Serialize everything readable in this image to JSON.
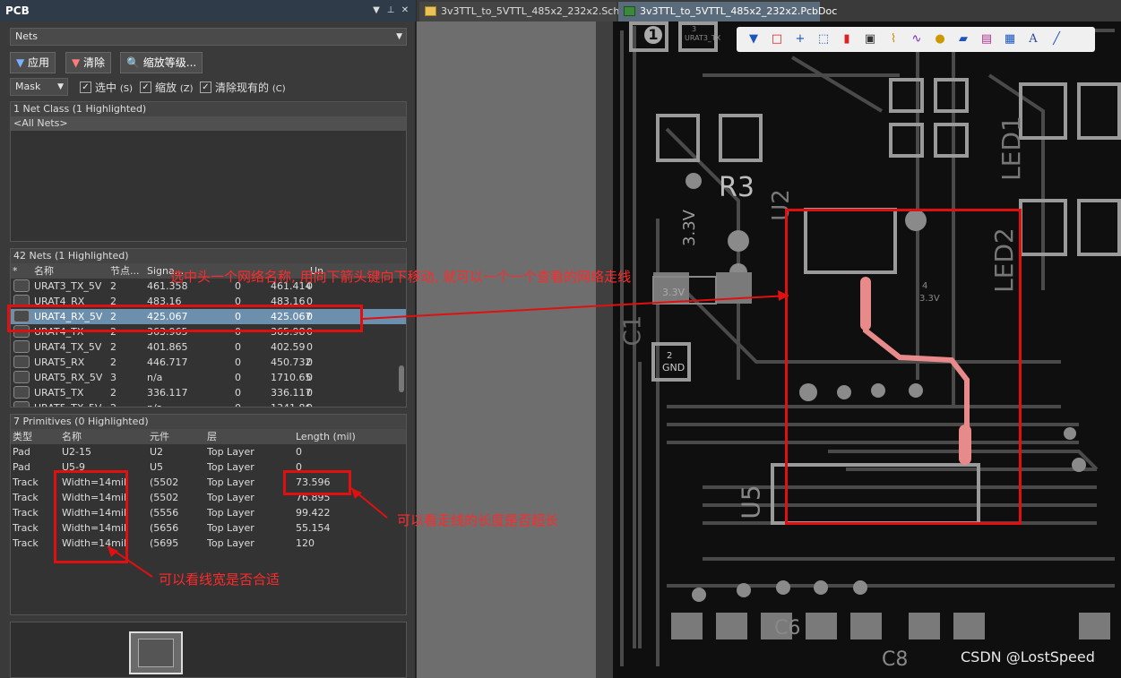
{
  "panel": {
    "title": "PCB",
    "nets_dropdown": "Nets",
    "buttons": {
      "apply": "应用",
      "clear": "清除",
      "zoom_level": "缩放等级..."
    },
    "mask_dropdown": "Mask",
    "checks": {
      "select": "选中",
      "select_key": "(S)",
      "zoom": "缩放",
      "zoom_key": "(Z)",
      "clear_existing": "清除现有的",
      "clear_existing_key": "(C)"
    },
    "net_class": {
      "header": "1 Net Class (1 Highlighted)",
      "items": [
        "<All Nets>"
      ]
    },
    "nets": {
      "header": "42 Nets (1 Highlighted)",
      "columns": [
        "*",
        "名称",
        "节点...",
        "Signa...",
        "",
        "Un"
      ],
      "rows": [
        {
          "name": "URAT3_TX_5V",
          "nodes": "2",
          "signal": "461.358",
          "v": "0",
          "routed": "461.414",
          "u": "0"
        },
        {
          "name": "URAT4_RX",
          "nodes": "2",
          "signal": "483.16",
          "v": "0",
          "routed": "483.16",
          "u": "0"
        },
        {
          "name": "URAT4_RX_5V",
          "nodes": "2",
          "signal": "425.067",
          "v": "0",
          "routed": "425.067",
          "u": "0"
        },
        {
          "name": "URAT4_TX",
          "nodes": "2",
          "signal": "363.965",
          "v": "0",
          "routed": "365.98",
          "u": "0"
        },
        {
          "name": "URAT4_TX_5V",
          "nodes": "2",
          "signal": "401.865",
          "v": "0",
          "routed": "402.59",
          "u": "0"
        },
        {
          "name": "URAT5_RX",
          "nodes": "2",
          "signal": "446.717",
          "v": "0",
          "routed": "450.732",
          "u": "0"
        },
        {
          "name": "URAT5_RX_5V",
          "nodes": "3",
          "signal": "n/a",
          "v": "0",
          "routed": "1710.65",
          "u": "0"
        },
        {
          "name": "URAT5_TX",
          "nodes": "2",
          "signal": "336.117",
          "v": "0",
          "routed": "336.117",
          "u": "0"
        },
        {
          "name": "URAT5_TX_5V",
          "nodes": "2",
          "signal": "n/a",
          "v": "0",
          "routed": "1341.86",
          "u": "0"
        }
      ]
    },
    "primitives": {
      "header": "7 Primitives (0 Highlighted)",
      "columns": [
        "类型",
        "名称",
        "元件",
        "层",
        "Length (mil)"
      ],
      "rows": [
        {
          "type": "Pad",
          "name": "U2-15",
          "comp": "U2",
          "layer": "Top Layer",
          "length": "0"
        },
        {
          "type": "Pad",
          "name": "U5-9",
          "comp": "U5",
          "layer": "Top Layer",
          "length": "0"
        },
        {
          "type": "Track",
          "name": "Width=14mil",
          "comp": "(5502",
          "layer": "Top Layer",
          "length": "73.596"
        },
        {
          "type": "Track",
          "name": "Width=14mil",
          "comp": "(5502",
          "layer": "Top Layer",
          "length": "76.895"
        },
        {
          "type": "Track",
          "name": "Width=14mil",
          "comp": "(5556",
          "layer": "Top Layer",
          "length": "99.422"
        },
        {
          "type": "Track",
          "name": "Width=14mil",
          "comp": "(5656",
          "layer": "Top Layer",
          "length": "55.154"
        },
        {
          "type": "Track",
          "name": "Width=14mil",
          "comp": "(5695",
          "layer": "Top Layer",
          "length": "120"
        }
      ]
    }
  },
  "tabs": [
    {
      "label": "3v3TTL_to_5VTTL_485x2_232x2.SchDoc"
    },
    {
      "label": "3v3TTL_to_5VTTL_485x2_232x2.PcbDoc"
    }
  ],
  "annotations": {
    "net_tip": "选中头一个网络名称, 用向下箭头键向下移动, 就可以一个一个查看的网络走线",
    "length_tip": "可以看走线的长度是否超长",
    "width_tip": "可以看线宽是否合适"
  },
  "pcb_labels": {
    "r3": "R3",
    "led1": "LED1",
    "led2": "LED2",
    "u5": "U5",
    "c1": "C1",
    "v33": "3.3V",
    "v33b": "3.3V",
    "gnd_num": "2",
    "gnd": "GND",
    "pin1": "1",
    "urat": "URAT3_TX",
    "num3": "3",
    "u2": "U2",
    "c6": "C6",
    "c8": "C8",
    "num4": "4",
    "v33c": "3.3V"
  },
  "watermark": "CSDN @LostSpeed",
  "colors": {
    "accent": "#6d8fae",
    "annotation": "#e01010",
    "trace": "#e88a8a"
  }
}
